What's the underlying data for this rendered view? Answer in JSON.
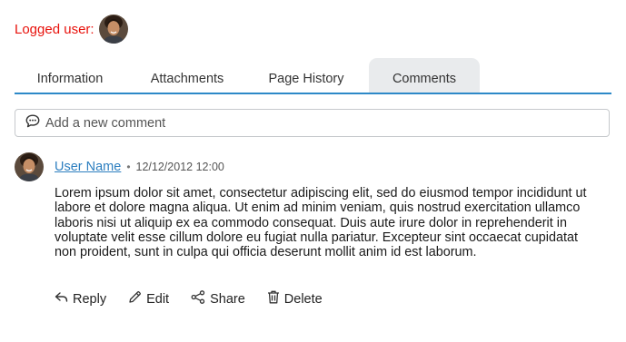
{
  "logged_user": {
    "label": "Logged user:"
  },
  "tabs": [
    {
      "label": "Information",
      "active": false
    },
    {
      "label": "Attachments",
      "active": false
    },
    {
      "label": "Page History",
      "active": false
    },
    {
      "label": "Comments",
      "active": true
    }
  ],
  "new_comment": {
    "placeholder": "Add a new comment",
    "icon": "chat-bubble-icon"
  },
  "comment": {
    "user_name": "User Name",
    "separator": "•",
    "timestamp": "12/12/2012 12:00",
    "body": "Lorem ipsum dolor sit amet, consectetur adipiscing elit, sed do eiusmod tempor incididunt ut labore et dolore magna aliqua. Ut enim ad minim veniam, quis nostrud exercitation ullamco laboris nisi ut aliquip ex ea commodo consequat. Duis aute irure dolor in reprehenderit in voluptate velit esse cillum dolore eu fugiat nulla pariatur. Excepteur sint occaecat cupidatat non proident, sunt in culpa qui officia deserunt mollit anim id est laborum.",
    "actions": [
      {
        "label": "Reply",
        "icon": "reply-icon"
      },
      {
        "label": "Edit",
        "icon": "pencil-icon"
      },
      {
        "label": "Share",
        "icon": "share-icon"
      },
      {
        "label": "Delete",
        "icon": "trash-icon"
      }
    ]
  },
  "colors": {
    "logged_label": "#e8120c",
    "accent": "#2d89c8",
    "link": "#2d7fc0",
    "active_tab_bg": "#e9ebed"
  }
}
